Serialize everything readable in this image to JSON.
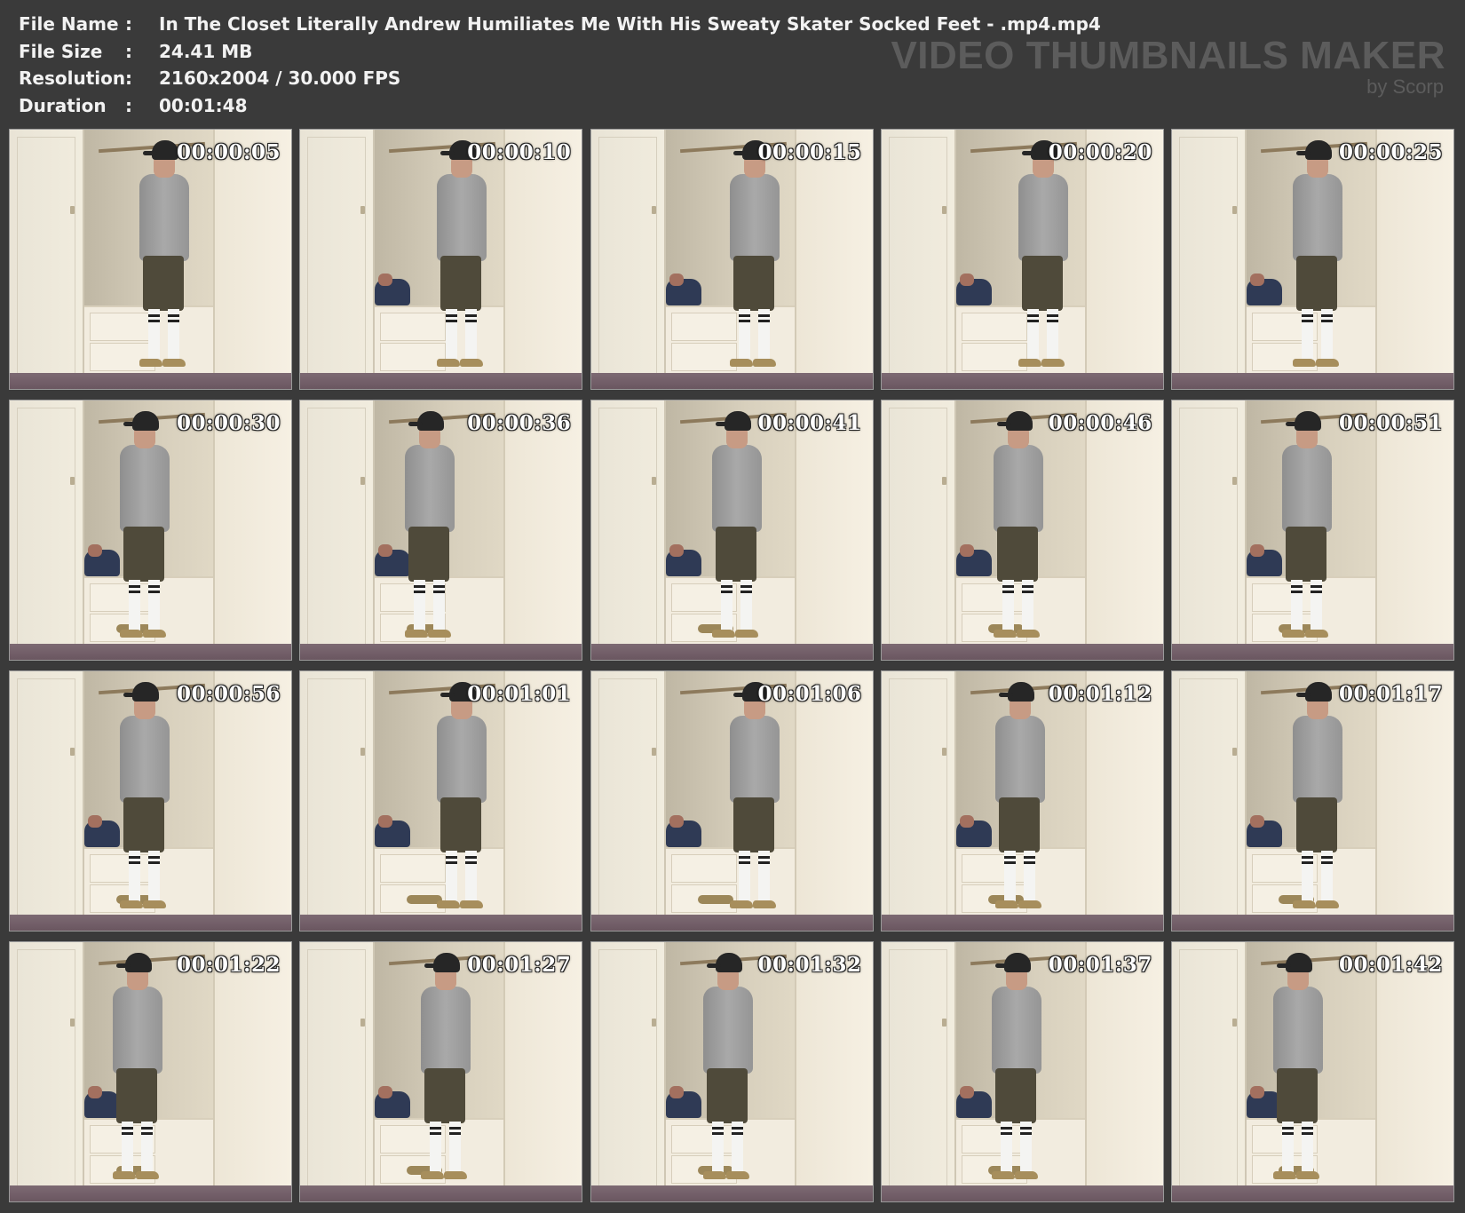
{
  "header": {
    "rows": [
      {
        "label": "File Name",
        "sep": ":",
        "value": "In The Closet Literally Andrew Humiliates Me With His Sweaty Skater Socked Feet - .mp4.mp4"
      },
      {
        "label": "File Size",
        "sep": ":",
        "value": "24.41 MB"
      },
      {
        "label": "Resolution",
        "sep": ":",
        "value": "2160x2004 / 30.000 FPS"
      },
      {
        "label": "Duration",
        "sep": ":",
        "value": "00:01:48"
      }
    ]
  },
  "brand": {
    "title": "VIDEO THUMBNAILS MAKER",
    "byline": "by Scorp"
  },
  "thumbnails": [
    {
      "time": "00:00:05"
    },
    {
      "time": "00:00:10"
    },
    {
      "time": "00:00:15"
    },
    {
      "time": "00:00:20"
    },
    {
      "time": "00:00:25"
    },
    {
      "time": "00:00:30"
    },
    {
      "time": "00:00:36"
    },
    {
      "time": "00:00:41"
    },
    {
      "time": "00:00:46"
    },
    {
      "time": "00:00:51"
    },
    {
      "time": "00:00:56"
    },
    {
      "time": "00:01:01"
    },
    {
      "time": "00:01:06"
    },
    {
      "time": "00:01:12"
    },
    {
      "time": "00:01:17"
    },
    {
      "time": "00:01:22"
    },
    {
      "time": "00:01:27"
    },
    {
      "time": "00:01:32"
    },
    {
      "time": "00:01:37"
    },
    {
      "time": "00:01:42"
    }
  ],
  "colors": {
    "background": "#3a3a3a",
    "header_text": "#f2f2f2",
    "brand_text": "#5c5c5c",
    "timestamp_text": "#ffffff"
  }
}
